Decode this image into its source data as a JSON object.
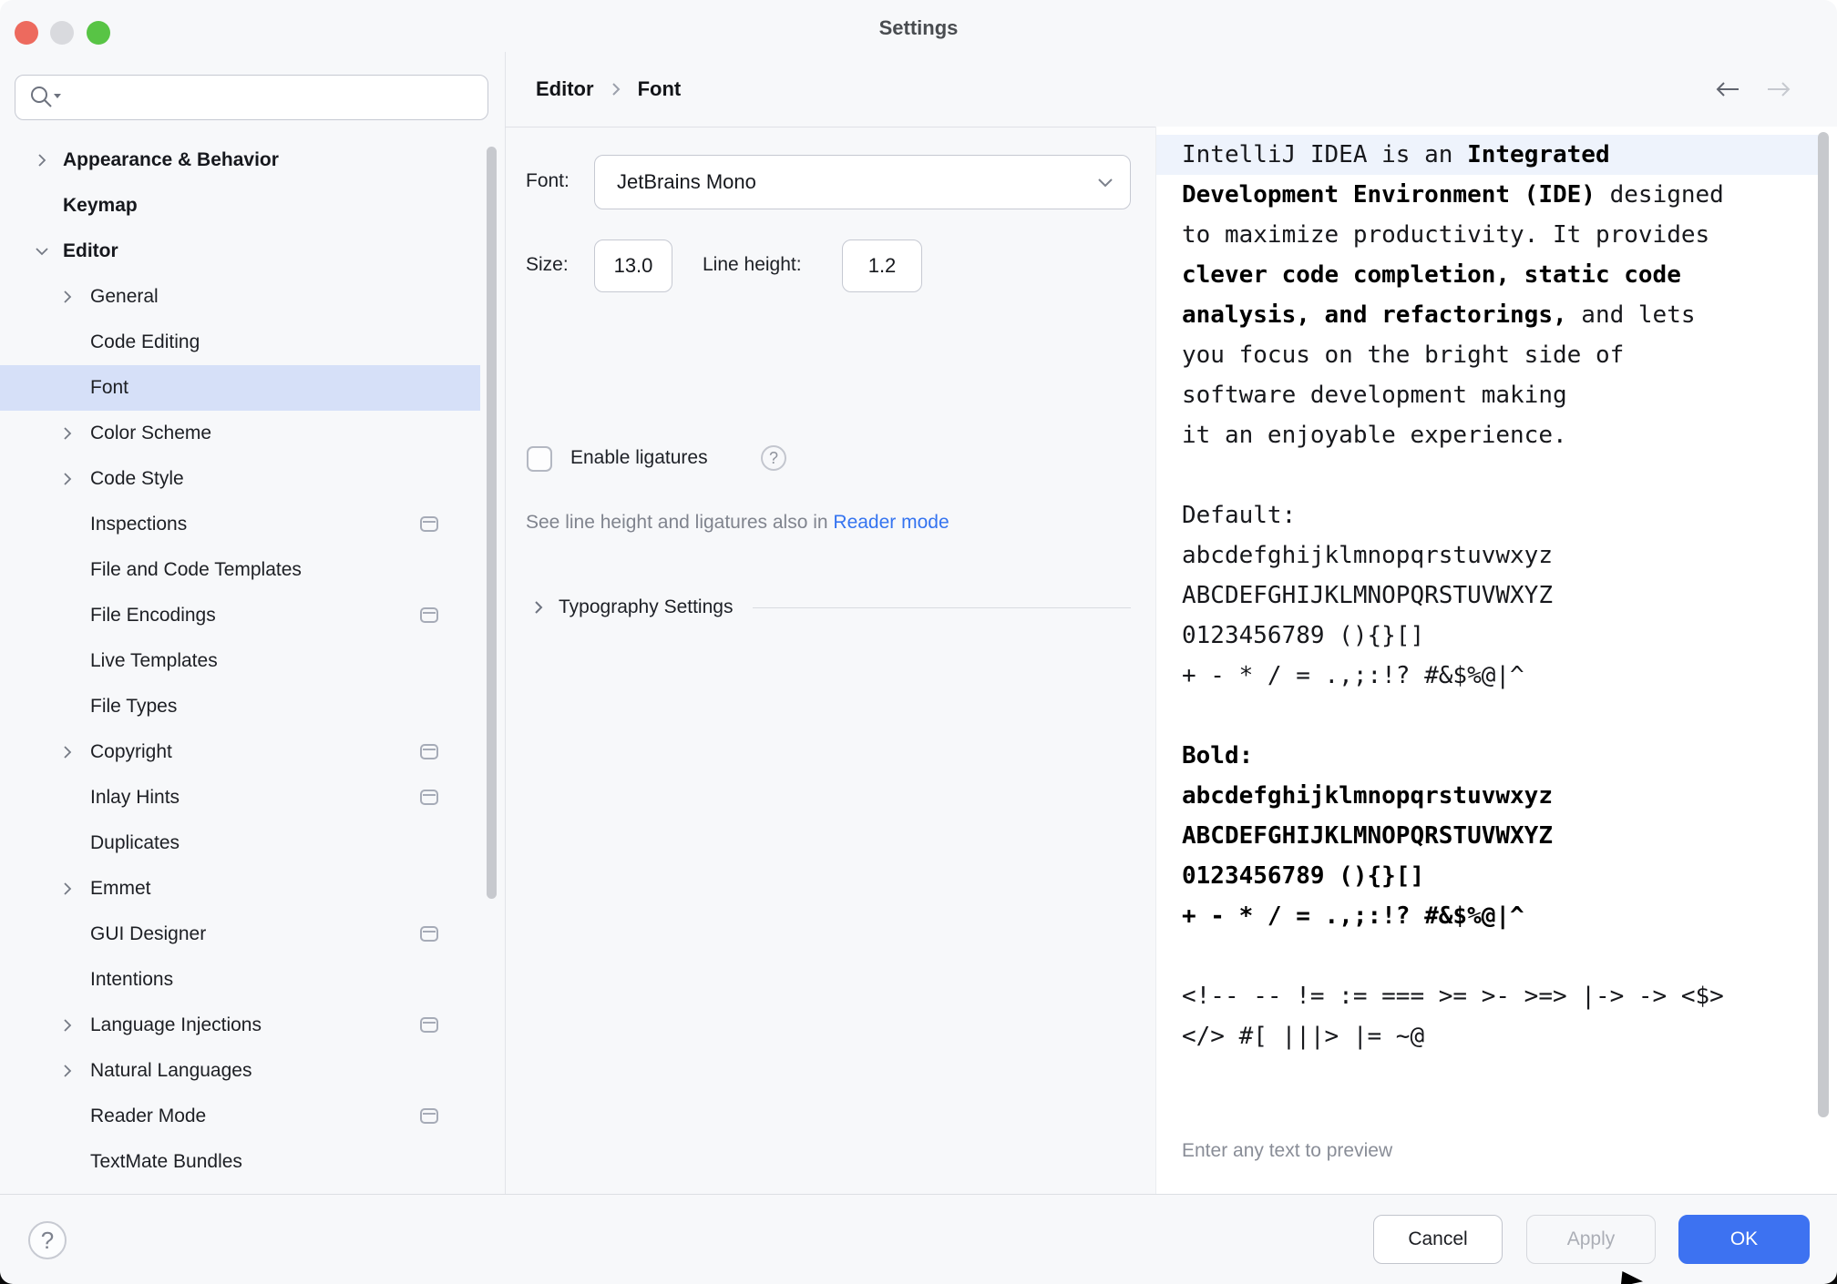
{
  "window": {
    "title": "Settings"
  },
  "titlebar": {
    "traffic_lights": [
      "close",
      "minimize",
      "zoom"
    ]
  },
  "colors": {
    "accent": "#3d72f1",
    "link": "#3574f0",
    "selection": "#d6e0f8",
    "traffic_red": "#ed6a5e",
    "traffic_gray": "#d9dade",
    "traffic_green": "#58c445"
  },
  "sidebar": {
    "search_placeholder": "",
    "items": [
      {
        "label": "Appearance & Behavior",
        "level": 0,
        "bold": true,
        "chevron": "right",
        "selected": false,
        "badge": false
      },
      {
        "label": "Keymap",
        "level": 0,
        "bold": true,
        "chevron": null,
        "selected": false,
        "badge": false
      },
      {
        "label": "Editor",
        "level": 0,
        "bold": true,
        "chevron": "down",
        "selected": false,
        "badge": false
      },
      {
        "label": "General",
        "level": 1,
        "bold": false,
        "chevron": "right",
        "selected": false,
        "badge": false
      },
      {
        "label": "Code Editing",
        "level": 1,
        "bold": false,
        "chevron": null,
        "selected": false,
        "badge": false
      },
      {
        "label": "Font",
        "level": 1,
        "bold": false,
        "chevron": null,
        "selected": true,
        "badge": false
      },
      {
        "label": "Color Scheme",
        "level": 1,
        "bold": false,
        "chevron": "right",
        "selected": false,
        "badge": false
      },
      {
        "label": "Code Style",
        "level": 1,
        "bold": false,
        "chevron": "right",
        "selected": false,
        "badge": false
      },
      {
        "label": "Inspections",
        "level": 1,
        "bold": false,
        "chevron": null,
        "selected": false,
        "badge": true
      },
      {
        "label": "File and Code Templates",
        "level": 1,
        "bold": false,
        "chevron": null,
        "selected": false,
        "badge": false
      },
      {
        "label": "File Encodings",
        "level": 1,
        "bold": false,
        "chevron": null,
        "selected": false,
        "badge": true
      },
      {
        "label": "Live Templates",
        "level": 1,
        "bold": false,
        "chevron": null,
        "selected": false,
        "badge": false
      },
      {
        "label": "File Types",
        "level": 1,
        "bold": false,
        "chevron": null,
        "selected": false,
        "badge": false
      },
      {
        "label": "Copyright",
        "level": 1,
        "bold": false,
        "chevron": "right",
        "selected": false,
        "badge": true
      },
      {
        "label": "Inlay Hints",
        "level": 1,
        "bold": false,
        "chevron": null,
        "selected": false,
        "badge": true
      },
      {
        "label": "Duplicates",
        "level": 1,
        "bold": false,
        "chevron": null,
        "selected": false,
        "badge": false
      },
      {
        "label": "Emmet",
        "level": 1,
        "bold": false,
        "chevron": "right",
        "selected": false,
        "badge": false
      },
      {
        "label": "GUI Designer",
        "level": 1,
        "bold": false,
        "chevron": null,
        "selected": false,
        "badge": true
      },
      {
        "label": "Intentions",
        "level": 1,
        "bold": false,
        "chevron": null,
        "selected": false,
        "badge": false
      },
      {
        "label": "Language Injections",
        "level": 1,
        "bold": false,
        "chevron": "right",
        "selected": false,
        "badge": true
      },
      {
        "label": "Natural Languages",
        "level": 1,
        "bold": false,
        "chevron": "right",
        "selected": false,
        "badge": false
      },
      {
        "label": "Reader Mode",
        "level": 1,
        "bold": false,
        "chevron": null,
        "selected": false,
        "badge": true
      },
      {
        "label": "TextMate Bundles",
        "level": 1,
        "bold": false,
        "chevron": null,
        "selected": false,
        "badge": false
      }
    ]
  },
  "header": {
    "breadcrumb": [
      "Editor",
      "Font"
    ],
    "back_icon": "arrow-left",
    "forward_icon": "arrow-right"
  },
  "form": {
    "font_label": "Font:",
    "font_value": "JetBrains Mono",
    "size_label": "Size:",
    "size_value": "13.0",
    "line_height_label": "Line height:",
    "line_height_value": "1.2",
    "ligatures_label": "Enable ligatures",
    "ligatures_checked": false,
    "hint_text": "See line height and ligatures also in ",
    "hint_link": "Reader mode",
    "typography_label": "Typography Settings"
  },
  "preview": {
    "footer_hint": "Enter any text to preview",
    "lines": [
      {
        "caret": true,
        "segments": [
          [
            "IntelliJ IDEA is an ",
            0
          ],
          [
            "Integrated",
            1
          ]
        ]
      },
      {
        "caret": false,
        "segments": [
          [
            "Development Environment (IDE)",
            1
          ],
          [
            " designed",
            0
          ]
        ]
      },
      {
        "caret": false,
        "segments": [
          [
            "to maximize productivity. It provides",
            0
          ]
        ]
      },
      {
        "caret": false,
        "segments": [
          [
            "clever code completion, static code",
            1
          ]
        ]
      },
      {
        "caret": false,
        "segments": [
          [
            "analysis, and refactorings,",
            1
          ],
          [
            " and lets",
            0
          ]
        ]
      },
      {
        "caret": false,
        "segments": [
          [
            "you focus on the bright side of",
            0
          ]
        ]
      },
      {
        "caret": false,
        "segments": [
          [
            "software development making",
            0
          ]
        ]
      },
      {
        "caret": false,
        "segments": [
          [
            "it an enjoyable experience.",
            0
          ]
        ]
      },
      {
        "caret": false,
        "segments": []
      },
      {
        "caret": false,
        "segments": [
          [
            "Default:",
            0
          ]
        ]
      },
      {
        "caret": false,
        "segments": [
          [
            "abcdefghijklmnopqrstuvwxyz",
            0
          ]
        ]
      },
      {
        "caret": false,
        "segments": [
          [
            "ABCDEFGHIJKLMNOPQRSTUVWXYZ",
            0
          ]
        ]
      },
      {
        "caret": false,
        "segments": [
          [
            "0123456789 (){}[]",
            0
          ]
        ]
      },
      {
        "caret": false,
        "segments": [
          [
            "+ - * / = .,;:!? #&$%@|^",
            0
          ]
        ]
      },
      {
        "caret": false,
        "segments": []
      },
      {
        "caret": false,
        "segments": [
          [
            "Bold:",
            1
          ]
        ]
      },
      {
        "caret": false,
        "segments": [
          [
            "abcdefghijklmnopqrstuvwxyz",
            1
          ]
        ]
      },
      {
        "caret": false,
        "segments": [
          [
            "ABCDEFGHIJKLMNOPQRSTUVWXYZ",
            1
          ]
        ]
      },
      {
        "caret": false,
        "segments": [
          [
            "0123456789 (){}[]",
            1
          ]
        ]
      },
      {
        "caret": false,
        "segments": [
          [
            "+ - * / = .,;:!? #&$%@|^",
            1
          ]
        ]
      },
      {
        "caret": false,
        "segments": []
      },
      {
        "caret": false,
        "segments": [
          [
            "<!-- -- != := === >= >- >=> |-> -> <$>",
            0
          ]
        ]
      },
      {
        "caret": false,
        "segments": [
          [
            "</> #[ |||> |= ~@",
            0
          ]
        ]
      }
    ]
  },
  "footer": {
    "help_icon": "question-mark",
    "help_label": "?",
    "cancel_label": "Cancel",
    "apply_label": "Apply",
    "ok_label": "OK"
  }
}
